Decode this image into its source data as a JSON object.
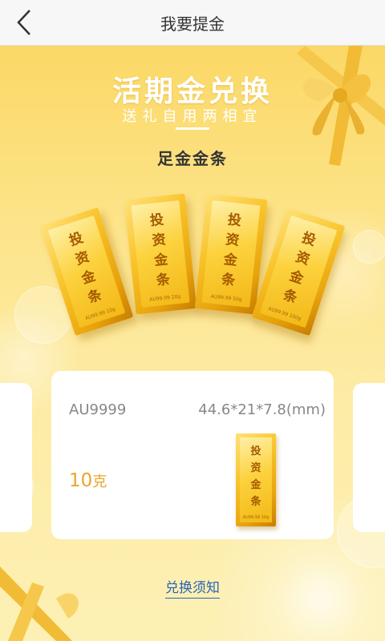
{
  "header": {
    "title": "我要提金"
  },
  "promo": {
    "title": "活期金兑换",
    "subtitle": "送礼自用两相宜",
    "product_name": "足金金条"
  },
  "bars": [
    {
      "chars": [
        "投",
        "资",
        "金",
        "条"
      ],
      "mark": "AU99.99 10g"
    },
    {
      "chars": [
        "投",
        "资",
        "金",
        "条"
      ],
      "mark": "AU99.99 20g"
    },
    {
      "chars": [
        "投",
        "资",
        "金",
        "条"
      ],
      "mark": "AU99.99 50g"
    },
    {
      "chars": [
        "投",
        "资",
        "金",
        "条"
      ],
      "mark": "AU99.99 100g"
    }
  ],
  "card": {
    "code": "AU9999",
    "dimensions": "44.6*21*7.8(mm)",
    "weight_value": "10",
    "weight_unit": "克",
    "bar_chars": [
      "投",
      "资",
      "金",
      "条"
    ],
    "bar_mark": "AU99.99 10g"
  },
  "footer": {
    "notice_link": "兑换须知"
  },
  "colors": {
    "accent_gold": "#e9a62a",
    "link_blue": "#2a64b8"
  }
}
